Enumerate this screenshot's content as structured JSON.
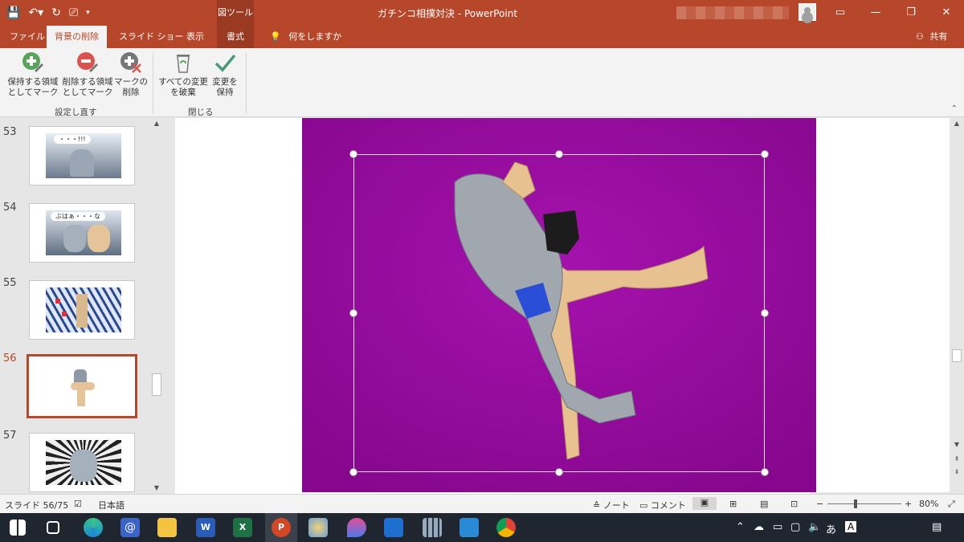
{
  "titlebar": {
    "qat_icons": [
      "save-icon",
      "undo-icon",
      "redo-icon",
      "present-icon",
      "customize-icon"
    ],
    "context_label": "図ツール",
    "title": "ガチンコ相撲対決  -  PowerPoint",
    "window_buttons": [
      "▭",
      "⧉",
      "✕"
    ]
  },
  "tabs": {
    "file": "ファイル",
    "background_removal": "背景の削除",
    "slideshow": "スライド ショー",
    "view": "表示",
    "format": "書式",
    "tell_me": "何をしますか",
    "share": "共有"
  },
  "ribbon": {
    "mark_keep_line1": "保持する領域",
    "mark_keep_line2": "としてマーク",
    "mark_remove_line1": "削除する領域",
    "mark_remove_line2": "としてマーク",
    "delete_mark_line1": "マークの",
    "delete_mark_line2": "削除",
    "discard_line1": "すべての変更",
    "discard_line2": "を破棄",
    "keep_line1": "変更を",
    "keep_line2": "保持",
    "group_refine": "設定し直す",
    "group_close": "閉じる"
  },
  "thumbnails": [
    {
      "num": "53",
      "caption": "・・・!!!"
    },
    {
      "num": "54",
      "caption": "ぶはぁ・・・な"
    },
    {
      "num": "55",
      "caption": ""
    },
    {
      "num": "56",
      "caption": ""
    },
    {
      "num": "57",
      "caption": ""
    }
  ],
  "colors": {
    "accent": "#b7472a",
    "photo_bg": "#9a0aa2"
  },
  "status": {
    "slide": "スライド 56/75",
    "language": "日本語",
    "notes": "ノート",
    "comments": "コメント",
    "zoom": "80%"
  },
  "taskbar": {
    "apps": [
      "start-icon",
      "taskview-icon",
      "edge-icon",
      "mail-at-icon",
      "explorer-icon",
      "word-icon",
      "excel-icon",
      "powerpoint-icon",
      "paint-icon",
      "paint3d-icon",
      "defender-icon",
      "calculator-icon",
      "mail-icon",
      "chrome-icon"
    ],
    "ime": "あ"
  }
}
